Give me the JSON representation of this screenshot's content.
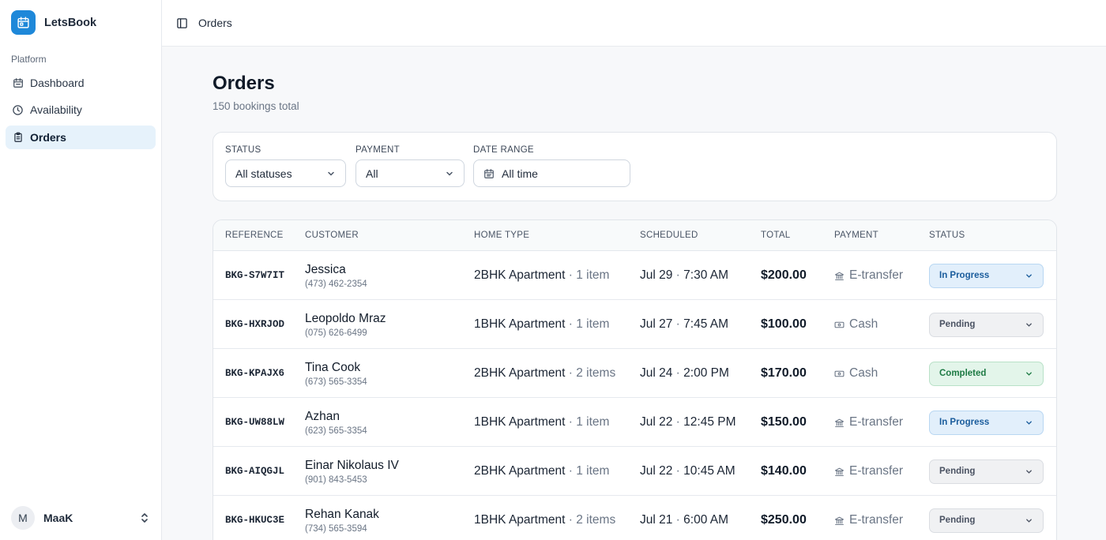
{
  "app": {
    "name": "LetsBook"
  },
  "sidebar": {
    "section": "Platform",
    "items": [
      {
        "label": "Dashboard",
        "icon": "calendar-grid-icon"
      },
      {
        "label": "Availability",
        "icon": "clock-icon"
      },
      {
        "label": "Orders",
        "icon": "clipboard-icon",
        "active": true
      }
    ],
    "user": {
      "initial": "M",
      "name": "MaaK"
    }
  },
  "topbar": {
    "title": "Orders"
  },
  "page": {
    "title": "Orders",
    "subtitle": "150 bookings total"
  },
  "filters": {
    "status": {
      "label": "STATUS",
      "value": "All statuses"
    },
    "payment": {
      "label": "PAYMENT",
      "value": "All"
    },
    "date_range": {
      "label": "DATE RANGE",
      "value": "All time"
    }
  },
  "table": {
    "columns": [
      "REFERENCE",
      "CUSTOMER",
      "HOME TYPE",
      "SCHEDULED",
      "TOTAL",
      "PAYMENT",
      "STATUS"
    ],
    "rows": [
      {
        "ref": "BKG-S7W7IT",
        "name": "Jessica",
        "phone": "(473) 462-2354",
        "home": "2BHK Apartment",
        "items": "1 item",
        "date": "Jul 29",
        "time": "7:30 AM",
        "total": "$200.00",
        "payment": "E-transfer",
        "payment_icon": "bank-icon",
        "status": "In Progress",
        "status_kind": "progress"
      },
      {
        "ref": "BKG-HXRJOD",
        "name": "Leopoldo Mraz",
        "phone": "(075) 626-6499",
        "home": "1BHK Apartment",
        "items": "1 item",
        "date": "Jul 27",
        "time": "7:45 AM",
        "total": "$100.00",
        "payment": "Cash",
        "payment_icon": "cash-icon",
        "status": "Pending",
        "status_kind": "pending"
      },
      {
        "ref": "BKG-KPAJX6",
        "name": "Tina Cook",
        "phone": "(673) 565-3354",
        "home": "2BHK Apartment",
        "items": "2 items",
        "date": "Jul 24",
        "time": "2:00 PM",
        "total": "$170.00",
        "payment": "Cash",
        "payment_icon": "cash-icon",
        "status": "Completed",
        "status_kind": "completed"
      },
      {
        "ref": "BKG-UW88LW",
        "name": "Azhan",
        "phone": "(623) 565-3354",
        "home": "1BHK Apartment",
        "items": "1 item",
        "date": "Jul 22",
        "time": "12:45 PM",
        "total": "$150.00",
        "payment": "E-transfer",
        "payment_icon": "bank-icon",
        "status": "In Progress",
        "status_kind": "progress"
      },
      {
        "ref": "BKG-AIQGJL",
        "name": "Einar Nikolaus IV",
        "phone": "(901) 843-5453",
        "home": "2BHK Apartment",
        "items": "1 item",
        "date": "Jul 22",
        "time": "10:45 AM",
        "total": "$140.00",
        "payment": "E-transfer",
        "payment_icon": "bank-icon",
        "status": "Pending",
        "status_kind": "pending"
      },
      {
        "ref": "BKG-HKUC3E",
        "name": "Rehan Kanak",
        "phone": "(734) 565-3594",
        "home": "1BHK Apartment",
        "items": "2 items",
        "date": "Jul 21",
        "time": "6:00 AM",
        "total": "$250.00",
        "payment": "E-transfer",
        "payment_icon": "bank-icon",
        "status": "Pending",
        "status_kind": "pending"
      }
    ]
  },
  "colors": {
    "brand": "#1e88d9",
    "active_nav_bg": "#e6f2fb",
    "status_progress": "#1a5c9c",
    "status_pending": "#4a5262",
    "status_completed": "#1d7a44"
  }
}
